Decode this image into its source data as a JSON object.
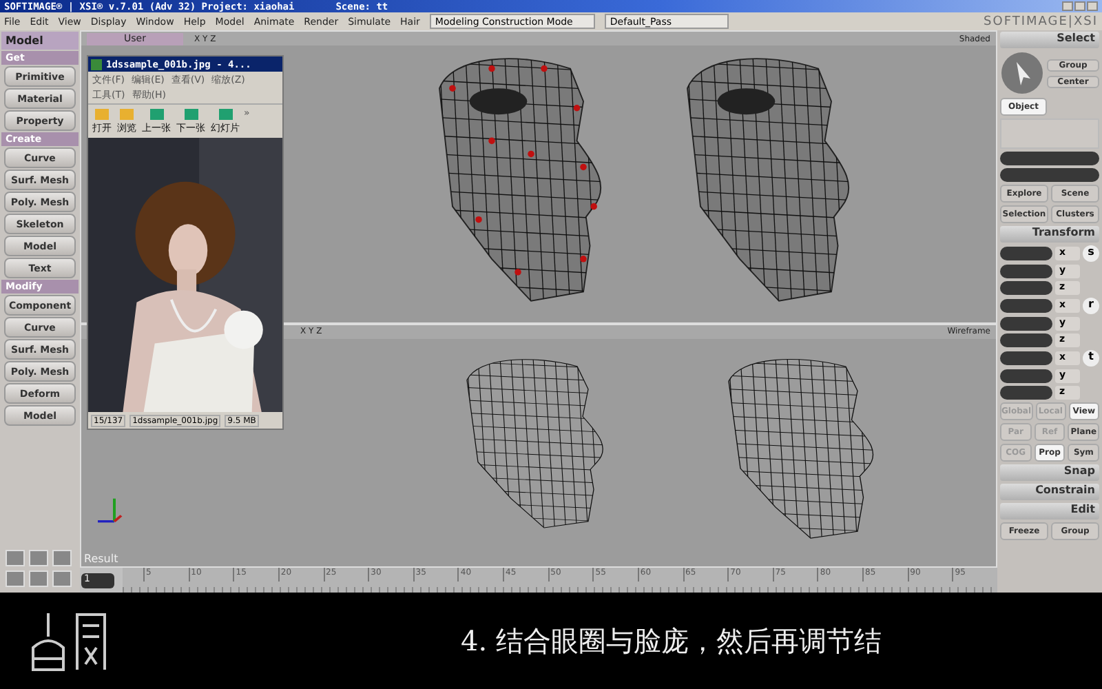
{
  "window": {
    "title": "SOFTIMAGE® | XSI® v.7.01 (Adv 32) Project: xiaohai",
    "scene": "Scene: tt"
  },
  "menu": [
    "File",
    "Edit",
    "View",
    "Display",
    "Window",
    "Help",
    "Model",
    "Animate",
    "Render",
    "Simulate",
    "Hair"
  ],
  "mode_dropdown": "Modeling Construction Mode",
  "pass_dropdown": "Default_Pass",
  "brand": "SOFTIMAGE|XSI",
  "left_toolbar": {
    "module": "Model",
    "sections": [
      {
        "title": "Get",
        "buttons": [
          "Primitive",
          "Material",
          "Property"
        ]
      },
      {
        "title": "Create",
        "buttons": [
          "Curve",
          "Surf. Mesh",
          "Poly. Mesh",
          "Skeleton",
          "Model",
          "Text"
        ]
      },
      {
        "title": "Modify",
        "buttons": [
          "Component",
          "Curve",
          "Surf. Mesh",
          "Poly. Mesh",
          "Deform",
          "Model"
        ]
      }
    ]
  },
  "viewports": [
    {
      "camera": "User",
      "axes": "X Y Z",
      "display": "Shaded",
      "kind": "shaded"
    },
    {
      "axes": "X Y Z",
      "display": "Wireframe",
      "kind": "wireframe",
      "label": "Result"
    }
  ],
  "viewer": {
    "title": "1dssample_001b.jpg - 4...",
    "menus": [
      "文件(F)",
      "编辑(E)",
      "查看(V)",
      "缩放(Z)",
      "工具(T)",
      "帮助(H)"
    ],
    "tools": [
      "打开",
      "浏览",
      "上一张",
      "下一张",
      "幻灯片"
    ],
    "more": "»",
    "count": "15/137",
    "file": "1dssample_001b.jpg",
    "size": "9.5 MB"
  },
  "timeline": {
    "frame": "1",
    "ticks": [
      "5",
      "10",
      "15",
      "20",
      "25",
      "30",
      "35",
      "40",
      "45",
      "50",
      "55",
      "60",
      "65",
      "70",
      "75",
      "80",
      "85",
      "90",
      "95"
    ]
  },
  "right_panel": {
    "select": {
      "title": "Select",
      "buttons": [
        "Group",
        "Center"
      ],
      "filter": {
        "label": "Object",
        "selected": true
      },
      "nav": [
        "Explore",
        "Scene",
        "Selection",
        "Clusters"
      ]
    },
    "transform": {
      "title": "Transform",
      "groups": [
        {
          "label": "s",
          "axes": [
            "x",
            "y",
            "z"
          ]
        },
        {
          "label": "r",
          "axes": [
            "x",
            "y",
            "z"
          ]
        },
        {
          "label": "t",
          "axes": [
            "x",
            "y",
            "z"
          ]
        }
      ],
      "modes": [
        [
          {
            "label": "Global",
            "selected": false,
            "disabled": true
          },
          {
            "label": "Local",
            "selected": false,
            "disabled": true
          },
          {
            "label": "View",
            "selected": true,
            "disabled": false
          }
        ],
        [
          {
            "label": "Par",
            "selected": false,
            "disabled": true
          },
          {
            "label": "Ref",
            "selected": false,
            "disabled": true
          },
          {
            "label": "Plane",
            "selected": false,
            "disabled": false
          }
        ],
        [
          {
            "label": "COG",
            "selected": false,
            "disabled": true
          },
          {
            "label": "Prop",
            "selected": true,
            "disabled": false
          },
          {
            "label": "Sym",
            "selected": false,
            "disabled": false
          }
        ]
      ]
    },
    "sections": [
      "Snap",
      "Constrain",
      "Edit"
    ],
    "edit_buttons": [
      "Freeze",
      "Group"
    ]
  },
  "caption": "4. 结合眼圈与脸庞，然后再调节结"
}
